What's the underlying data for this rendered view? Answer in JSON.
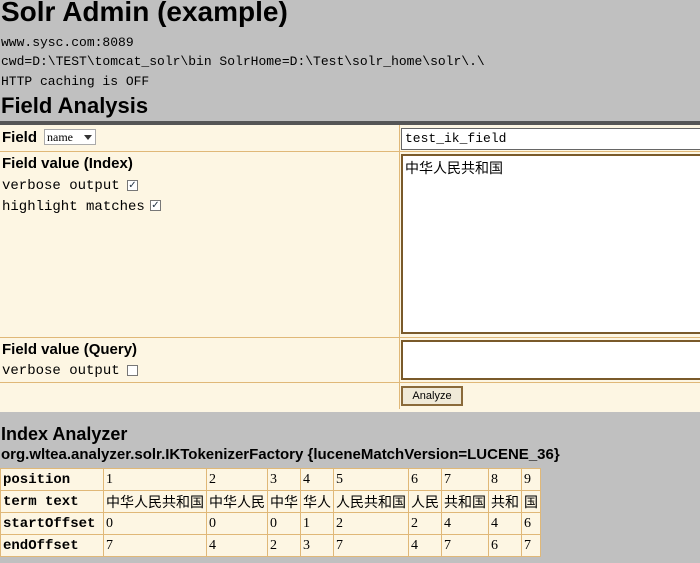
{
  "header": {
    "title": "Solr Admin (example)",
    "host": "www.sysc.com:8089",
    "cwd": "cwd=D:\\TEST\\tomcat_solr\\bin SolrHome=D:\\Test\\solr_home\\solr\\.\\",
    "caching": "HTTP caching is OFF"
  },
  "section_title": "Field Analysis",
  "form": {
    "field_label": "Field",
    "field_type_selected": "name",
    "field_name_value": "test_ik_field",
    "index_label": "Field value (Index)",
    "index_verbose_label": "verbose output",
    "index_verbose_checked": "✓",
    "highlight_label": "highlight matches",
    "highlight_checked": "✓",
    "index_value": "中华人民共和国",
    "query_label": "Field value (Query)",
    "query_verbose_label": "verbose output",
    "query_value": "",
    "analyze_button": "Analyze"
  },
  "analyzer": {
    "title": "Index Analyzer",
    "tokenizer": "org.wltea.analyzer.solr.IKTokenizerFactory {luceneMatchVersion=LUCENE_36}",
    "row_labels": {
      "position": "position",
      "term_text": "term text",
      "start_offset": "startOffset",
      "end_offset": "endOffset"
    },
    "tokens": [
      {
        "position": "1",
        "term": "中华人民共和国",
        "start": "0",
        "end": "7"
      },
      {
        "position": "2",
        "term": "中华人民",
        "start": "0",
        "end": "4"
      },
      {
        "position": "3",
        "term": "中华",
        "start": "0",
        "end": "2"
      },
      {
        "position": "4",
        "term": "华人",
        "start": "1",
        "end": "3"
      },
      {
        "position": "5",
        "term": "人民共和国",
        "start": "2",
        "end": "7"
      },
      {
        "position": "6",
        "term": "人民",
        "start": "2",
        "end": "4"
      },
      {
        "position": "7",
        "term": "共和国",
        "start": "4",
        "end": "7"
      },
      {
        "position": "8",
        "term": "共和",
        "start": "4",
        "end": "6"
      },
      {
        "position": "9",
        "term": "国",
        "start": "6",
        "end": "7"
      }
    ]
  }
}
